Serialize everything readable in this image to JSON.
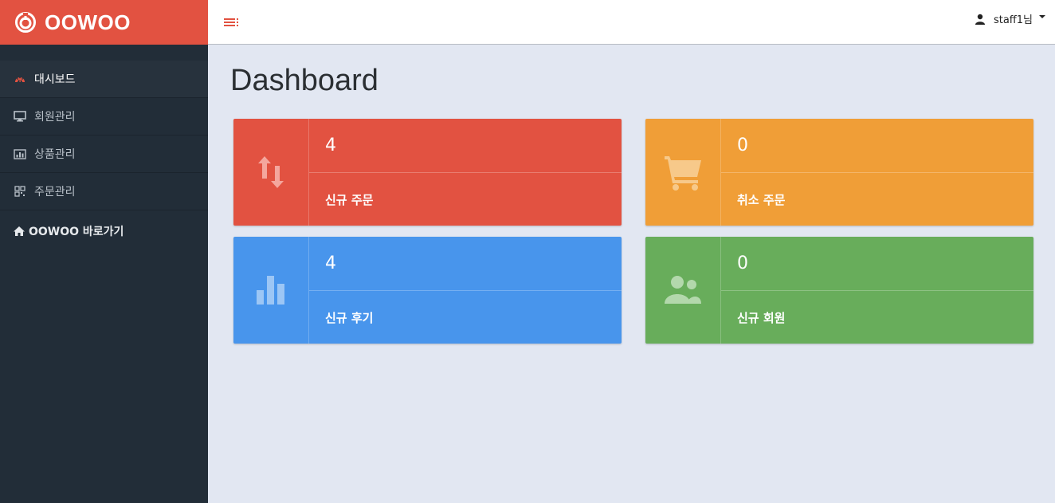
{
  "brand": {
    "name": "OOWOO"
  },
  "sidebar": {
    "items": [
      {
        "label": "대시보드",
        "icon": "dashboard-icon"
      },
      {
        "label": "회원관리",
        "icon": "monitor-icon"
      },
      {
        "label": "상품관리",
        "icon": "bar-chart-icon"
      },
      {
        "label": "주문관리",
        "icon": "grid-icon"
      }
    ],
    "home_link": {
      "label": "OOWOO 바로가기",
      "icon": "home-icon"
    }
  },
  "topbar": {
    "user_label": "staff1님"
  },
  "page": {
    "title": "Dashboard"
  },
  "cards": [
    {
      "value": "4",
      "label": "신규 주문",
      "color": "#e25241",
      "icon": "sort-arrows-icon"
    },
    {
      "value": "0",
      "label": "취소 주문",
      "color": "#f09e37",
      "icon": "shopping-cart-icon"
    },
    {
      "value": "4",
      "label": "신규 후기",
      "color": "#4895ec",
      "icon": "bar-chart-icon"
    },
    {
      "value": "0",
      "label": "신규 회원",
      "color": "#68ad5b",
      "icon": "users-icon"
    }
  ],
  "colors": {
    "accent": "#e25241",
    "sidebar": "#222d38",
    "background": "#e2e7f2"
  }
}
